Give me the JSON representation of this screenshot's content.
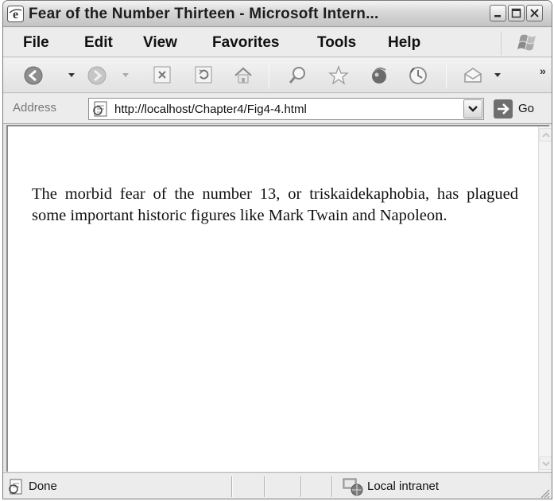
{
  "window": {
    "title": "Fear of the Number Thirteen - Microsoft Intern..."
  },
  "menu": {
    "items": [
      {
        "label": "File"
      },
      {
        "label": "Edit"
      },
      {
        "label": "View"
      },
      {
        "label": "Favorites"
      },
      {
        "label": "Tools"
      },
      {
        "label": "Help"
      }
    ]
  },
  "toolbar": {
    "buttons": [
      {
        "name": "back",
        "icon": "back-arrow-icon"
      },
      {
        "name": "forward",
        "icon": "forward-arrow-icon"
      },
      {
        "name": "stop",
        "icon": "stop-icon"
      },
      {
        "name": "refresh",
        "icon": "refresh-icon"
      },
      {
        "name": "home",
        "icon": "home-icon"
      },
      {
        "name": "search",
        "icon": "search-icon"
      },
      {
        "name": "favorites",
        "icon": "star-icon"
      },
      {
        "name": "media",
        "icon": "media-icon"
      },
      {
        "name": "history",
        "icon": "history-icon"
      },
      {
        "name": "mail",
        "icon": "mail-icon"
      }
    ],
    "more": "»"
  },
  "address": {
    "label": "Address",
    "url": "http://localhost/Chapter4/Fig4-4.html",
    "go_label": "Go"
  },
  "content": {
    "paragraph": "The morbid fear of the number 13, or triskaidekaphobia, has plagued some important historic figures like Mark Twain and Napoleon."
  },
  "status": {
    "text": "Done",
    "zone": "Local intranet"
  },
  "colors": {
    "chrome": "#e4e4e4",
    "content_bg": "#ffffff",
    "text": "#111111"
  }
}
